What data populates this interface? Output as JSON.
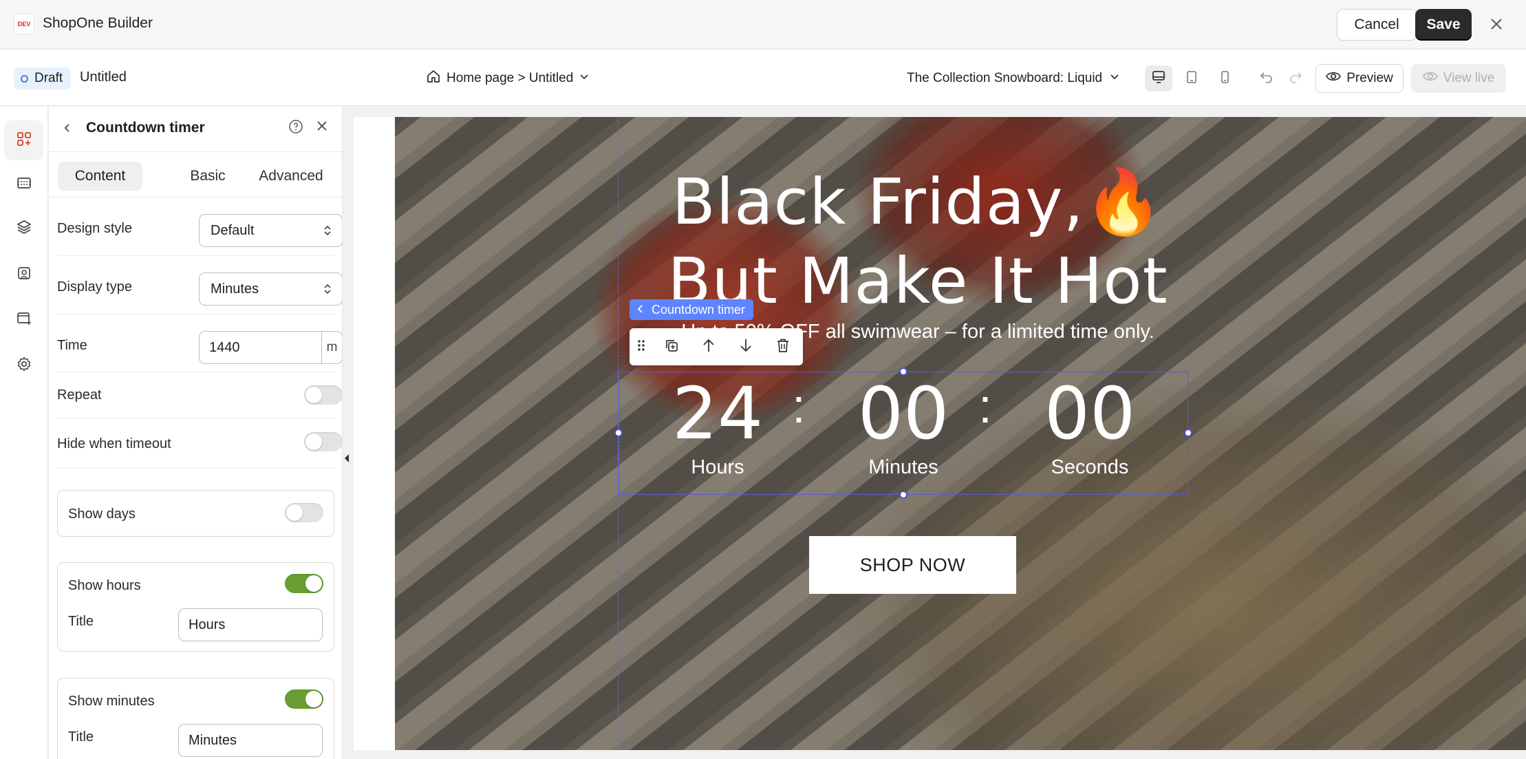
{
  "app": {
    "title": "ShopOne Builder",
    "logo_text": "DEV"
  },
  "topbar": {
    "cancel_label": "Cancel",
    "save_label": "Save"
  },
  "subbar": {
    "status": "Draft",
    "page_name": "Untitled",
    "breadcrumb": "Home page > Untitled",
    "template": "The Collection Snowboard: Liquid",
    "preview_label": "Preview",
    "view_live_label": "View live"
  },
  "panel": {
    "title": "Countdown timer",
    "tabs": [
      {
        "label": "Content",
        "active": true
      },
      {
        "label": "Basic",
        "active": false
      },
      {
        "label": "Advanced",
        "active": false
      }
    ],
    "design_style": {
      "label": "Design style",
      "value": "Default"
    },
    "display_type": {
      "label": "Display type",
      "value": "Minutes"
    },
    "time": {
      "label": "Time",
      "value": "1440",
      "unit": "m"
    },
    "repeat": {
      "label": "Repeat",
      "on": false
    },
    "hide_when_timeout": {
      "label": "Hide when timeout",
      "on": false
    },
    "show_days": {
      "label": "Show days",
      "on": false
    },
    "show_hours": {
      "label": "Show hours",
      "on": true,
      "title_label": "Title",
      "title_value": "Hours"
    },
    "show_minutes": {
      "label": "Show minutes",
      "on": true,
      "title_label": "Title",
      "title_value": "Minutes"
    }
  },
  "canvas": {
    "headline_1": "Black Friday,🔥",
    "headline_2": "But Make It Hot",
    "subtitle": "Up to 50% OFF all swimwear – for a limited time only.",
    "selection_tag": "Countdown timer",
    "countdown": {
      "hours": "24",
      "minutes": "00",
      "seconds": "00",
      "separator": ":",
      "hours_label": "Hours",
      "minutes_label": "Minutes",
      "seconds_label": "Seconds"
    },
    "cta_label": "SHOP NOW"
  },
  "colors": {
    "accent_toggle": "#6b9e32",
    "selection": "#5f84ff",
    "save_button": "#2b2b2b"
  }
}
